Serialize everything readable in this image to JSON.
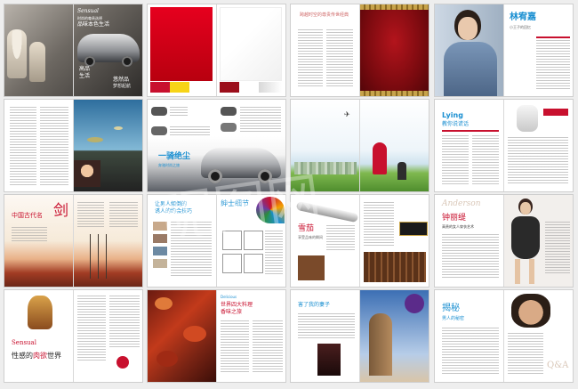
{
  "s1": {
    "magazine_title": "Sensual",
    "cover_tag1": "时尚的尊贵选择",
    "cover_tag2": "品味本色生活",
    "cover_l1": "高品",
    "cover_l2": "生活",
    "cover_r1": "悠然品",
    "cover_r2": "梦想起航"
  },
  "s3": {
    "headline": "跨越时空的尊贵传世经典"
  },
  "s4": {
    "name": "林宥嘉",
    "sub": "小王子的回忆"
  },
  "s6": {
    "headline": "一骑绝尘",
    "sub": "奔驰时尚之旅"
  },
  "s8": {
    "brand": "Lying",
    "headline": "教你说谎话"
  },
  "s9": {
    "headline": "中国古代名",
    "big": "剑"
  },
  "s10": {
    "left_head1": "让男人傾倒的",
    "left_head2": "诱人的约会技巧",
    "right_head": "绅士细节"
  },
  "s11": {
    "headline": "雪茄",
    "sub": "享受品味的瞬间"
  },
  "s12": {
    "script": "Anderson",
    "name": "钟丽缇",
    "sub": "高贵的女人穿衣艺术"
  },
  "s13": {
    "brand": "Sensual",
    "headline1": "性感的",
    "headline2": "肉欲",
    "headline3": "世界"
  },
  "s14": {
    "eng": "Delicious",
    "head1": "世界四大料理",
    "head2": "香味之旅"
  },
  "s15": {
    "head": "害了我的妻子"
  },
  "s16": {
    "head1": "揭秘",
    "head2": "男人的秘密",
    "qa": "Q&A"
  },
  "watermark": "昵图网"
}
